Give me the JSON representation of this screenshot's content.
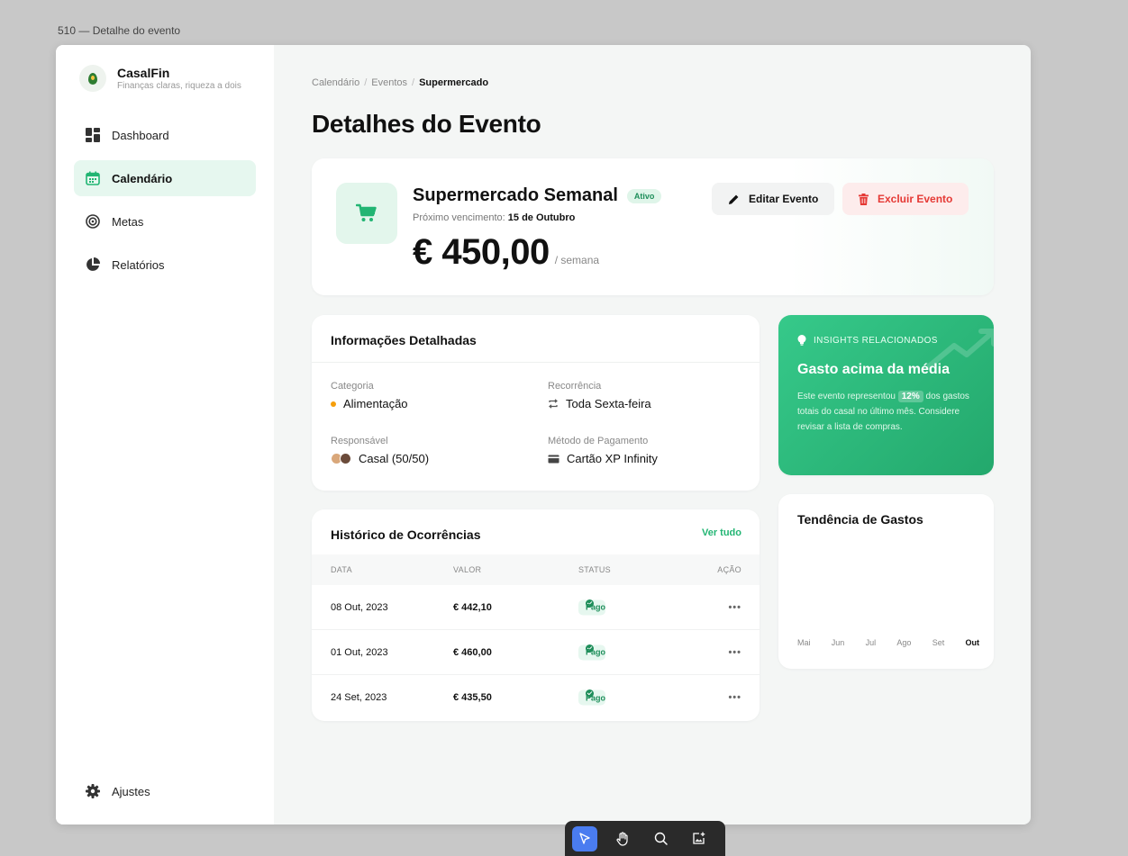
{
  "window": {
    "title": "510 — Detalhe do evento"
  },
  "brand": {
    "name": "CasalFin",
    "tagline": "Finanças claras, riqueza a dois"
  },
  "nav": {
    "items": [
      {
        "label": "Dashboard",
        "icon": "dashboard-icon",
        "active": false
      },
      {
        "label": "Calendário",
        "icon": "calendar-icon",
        "active": true
      },
      {
        "label": "Metas",
        "icon": "target-icon",
        "active": false
      },
      {
        "label": "Relatórios",
        "icon": "pie-chart-icon",
        "active": false
      }
    ],
    "settings_label": "Ajustes"
  },
  "breadcrumb": {
    "items": [
      "Calendário",
      "Eventos"
    ],
    "separator": "/",
    "current": "Supermercado"
  },
  "page": {
    "title": "Detalhes do Evento"
  },
  "event": {
    "name": "Supermercado Semanal",
    "status": "Ativo",
    "due_label": "Próximo vencimento:",
    "due_date": "15 de Outubro",
    "amount": "€ 450,00",
    "period": "/ semana",
    "icon": "cart-icon",
    "edit_label": "Editar Evento",
    "delete_label": "Excluir Evento"
  },
  "details": {
    "heading": "Informações Detalhadas",
    "category_label": "Categoria",
    "category_value": "Alimentação",
    "recurrence_label": "Recorrência",
    "recurrence_value": "Toda Sexta-feira",
    "owner_label": "Responsável",
    "owner_value": "Casal (50/50)",
    "payment_label": "Método de Pagamento",
    "payment_value": "Cartão XP Infinity"
  },
  "history": {
    "heading": "Histórico de Ocorrências",
    "see_all": "Ver tudo",
    "columns": [
      "DATA",
      "VALOR",
      "STATUS",
      "AÇÃO"
    ],
    "rows": [
      {
        "date": "08 Out, 2023",
        "value": "€ 442,10",
        "status": "Pago",
        "action": "•••"
      },
      {
        "date": "01 Out, 2023",
        "value": "€ 460,00",
        "status": "Pago",
        "action": "•••"
      },
      {
        "date": "24 Set, 2023",
        "value": "€ 435,50",
        "status": "Pago",
        "action": "•••"
      }
    ]
  },
  "insight": {
    "tag": "INSIGHTS RELACIONADOS",
    "title": "Gasto acima da média",
    "text_before": "Este evento representou",
    "highlight": "12%",
    "text_after": "dos gastos totais do casal no último mês. Considere revisar a lista de compras."
  },
  "trend": {
    "heading": "Tendência de Gastos",
    "months": [
      "Mai",
      "Jun",
      "Jul",
      "Ago",
      "Set",
      "Out"
    ],
    "current_month": "Out"
  },
  "toolbar": {
    "tools": [
      "pointer-icon",
      "hand-icon",
      "zoom-icon",
      "image-add-icon"
    ],
    "active_tool": "pointer-icon"
  },
  "colors": {
    "accent": "#22b573",
    "danger": "#e53935",
    "warning": "#f59e0b"
  }
}
